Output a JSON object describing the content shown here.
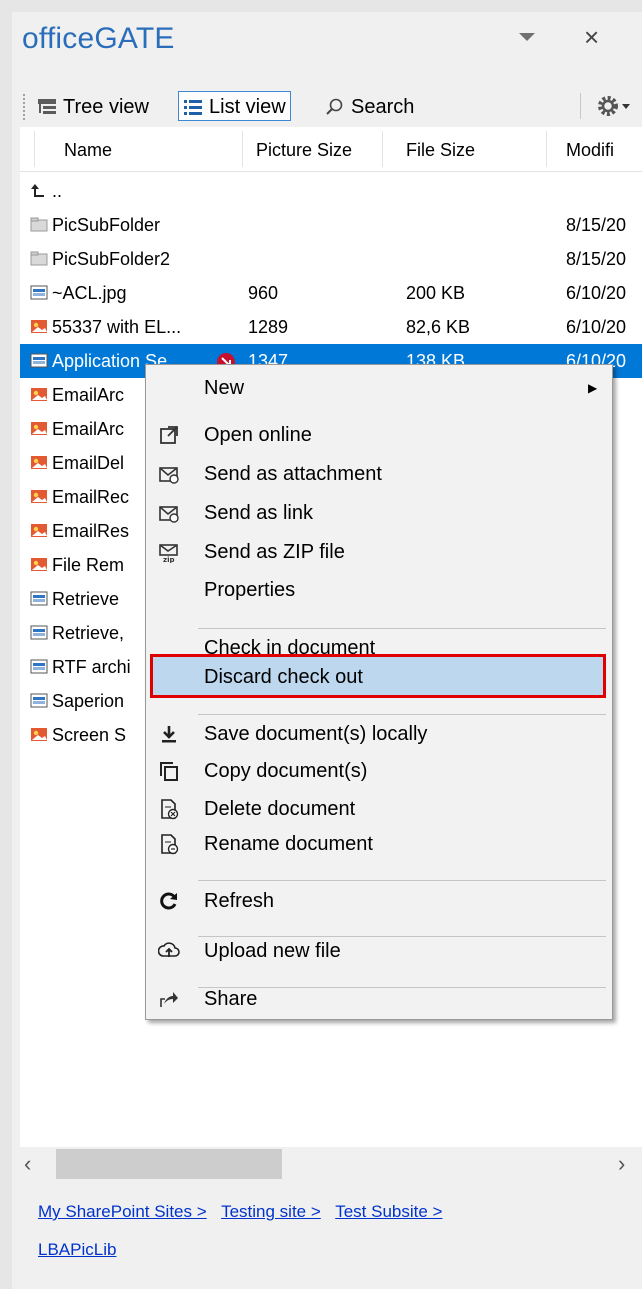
{
  "pane": {
    "title": "officeGATE",
    "menu_icon": "chevron-down-icon",
    "close_label": "×"
  },
  "toolbar": {
    "tree_view": "Tree view",
    "list_view": "List view",
    "search": "Search",
    "settings_icon": "gear-icon"
  },
  "grid": {
    "columns": [
      "Name",
      "Picture Size",
      "File Size",
      "Modifi"
    ],
    "parent_row": "..",
    "rows": [
      {
        "name": "PicSubFolder",
        "picture_size": "",
        "file_size": "",
        "modified": "8/15/20",
        "icon": "folder-icon"
      },
      {
        "name": "PicSubFolder2",
        "picture_size": "",
        "file_size": "",
        "modified": "8/15/20",
        "icon": "folder-icon"
      },
      {
        "name": "~ACL.jpg",
        "picture_size": "960",
        "file_size": "200 KB",
        "modified": "6/10/20",
        "icon": "image-icon"
      },
      {
        "name": "55337 with EL...",
        "picture_size": "1289",
        "file_size": "82,6 KB",
        "modified": "6/10/20",
        "icon": "picture-icon"
      },
      {
        "name": "Application Se",
        "picture_size": "1347",
        "file_size": "138 KB",
        "modified": "6/10/20",
        "icon": "image-icon",
        "selected": true,
        "checked_out": true
      },
      {
        "name": "EmailArc",
        "picture_size": "",
        "file_size": "",
        "modified": "/20",
        "icon": "picture-icon"
      },
      {
        "name": "EmailArc",
        "picture_size": "",
        "file_size": "",
        "modified": "/20",
        "icon": "picture-icon"
      },
      {
        "name": "EmailDel",
        "picture_size": "",
        "file_size": "",
        "modified": "/20",
        "icon": "picture-icon"
      },
      {
        "name": "EmailRec",
        "picture_size": "",
        "file_size": "",
        "modified": "/20",
        "icon": "picture-icon"
      },
      {
        "name": "EmailRes",
        "picture_size": "",
        "file_size": "",
        "modified": "/20",
        "icon": "picture-icon"
      },
      {
        "name": "File Rem",
        "picture_size": "",
        "file_size": "",
        "modified": "/20",
        "icon": "picture-icon"
      },
      {
        "name": "Retrieve",
        "picture_size": "",
        "file_size": "",
        "modified": "/20",
        "icon": "image-icon"
      },
      {
        "name": "Retrieve,",
        "picture_size": "",
        "file_size": "",
        "modified": "/20",
        "icon": "image-icon"
      },
      {
        "name": "RTF archi",
        "picture_size": "",
        "file_size": "",
        "modified": "/20",
        "icon": "image-icon"
      },
      {
        "name": "Saperion",
        "picture_size": "",
        "file_size": "",
        "modified": "/20",
        "icon": "image-icon"
      },
      {
        "name": "Screen S",
        "picture_size": "",
        "file_size": "",
        "modified": "/20",
        "icon": "picture-icon"
      }
    ]
  },
  "context_menu": {
    "items": [
      {
        "label": "New",
        "icon": "",
        "submenu": true
      },
      {
        "label": "Open online",
        "icon": "open-external-icon"
      },
      {
        "label": "Send as attachment",
        "icon": "mail-attachment-icon"
      },
      {
        "label": "Send as link",
        "icon": "mail-link-icon"
      },
      {
        "label": "Send as ZIP file",
        "icon": "mail-zip-icon"
      },
      {
        "label": "Properties",
        "icon": ""
      },
      {
        "label": "Check in document",
        "icon": ""
      },
      {
        "label": "Discard check out",
        "icon": "",
        "highlighted": true
      },
      {
        "label": "Save document(s) locally",
        "icon": "download-icon"
      },
      {
        "label": "Copy document(s)",
        "icon": "copy-icon"
      },
      {
        "label": "Delete document",
        "icon": "delete-document-icon"
      },
      {
        "label": "Rename document",
        "icon": "rename-document-icon"
      },
      {
        "label": "Refresh",
        "icon": "refresh-icon"
      },
      {
        "label": "Upload new file",
        "icon": "upload-icon"
      },
      {
        "label": "Share",
        "icon": "share-icon"
      }
    ]
  },
  "scrollbar": {
    "left": "‹",
    "right": "›"
  },
  "breadcrumbs": [
    "My SharePoint Sites >",
    "Testing site >",
    "Test Subsite >",
    "LBAPicLib"
  ],
  "colors": {
    "accent": "#2a6ebb",
    "selection": "#0078d7",
    "highlight_border": "#e00000",
    "highlight_fill": "#bdd7ee"
  }
}
